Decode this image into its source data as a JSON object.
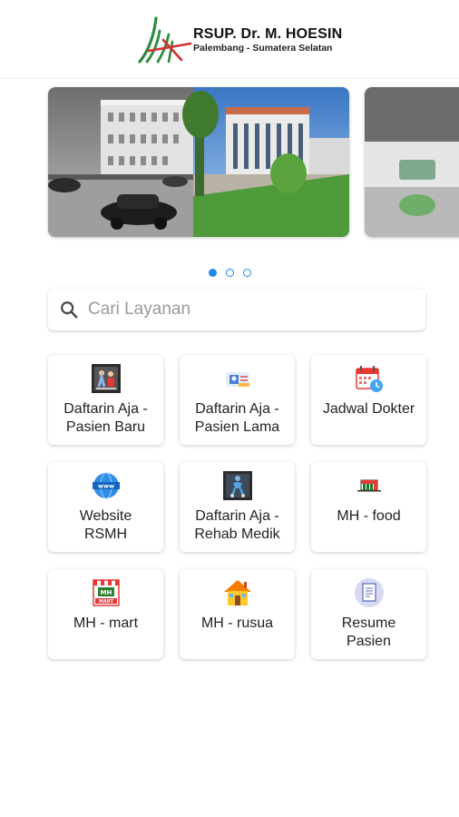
{
  "header": {
    "title": "RSUP. Dr. M. HOESIN",
    "subtitle": "Palembang - Sumatera Selatan"
  },
  "carousel": {
    "slides": [
      "hospital-building-photo",
      "hospital-interior-photo"
    ],
    "page_count": 3,
    "active_index": 0
  },
  "search": {
    "placeholder": "Cari Layanan",
    "value": ""
  },
  "services": [
    {
      "label": "Daftarin Aja -\nPasien Baru",
      "icon": "new-patient-icon"
    },
    {
      "label": "Daftarin Aja -\nPasien Lama",
      "icon": "returning-patient-icon"
    },
    {
      "label": "Jadwal Dokter",
      "icon": "calendar-icon"
    },
    {
      "label": "Website\nRSMH",
      "icon": "www-globe-icon"
    },
    {
      "label": "Daftarin Aja -\nRehab Medik",
      "icon": "rehab-icon"
    },
    {
      "label": "MH - food",
      "icon": "food-store-icon"
    },
    {
      "label": "MH - mart",
      "icon": "mart-store-icon"
    },
    {
      "label": "MH - rusua",
      "icon": "house-icon"
    },
    {
      "label": "Resume\nPasien",
      "icon": "document-icon"
    }
  ],
  "colors": {
    "accent": "#1e88e5",
    "logo_green": "#2e8b3e",
    "logo_red": "#d32f2f"
  }
}
